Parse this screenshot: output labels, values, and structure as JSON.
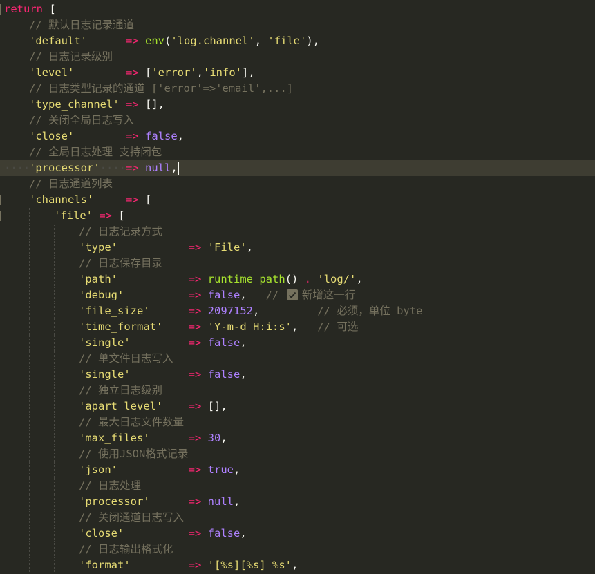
{
  "colors": {
    "background": "#272822",
    "current_line": "#3e3d32",
    "keyword": "#f92672",
    "string": "#e6db74",
    "function": "#a6e22e",
    "constant": "#ae81ff",
    "comment": "#75715e",
    "text": "#f8f8f2"
  },
  "icons": {
    "check": "check-mark-icon"
  },
  "code": {
    "l1": {
      "kw": "return",
      "pun": " ["
    },
    "l2": {
      "cmt": "// 默认日志记录通道"
    },
    "l3": {
      "key": "'default'",
      "pad": "      ",
      "op": "=>",
      "fn": "env",
      "p1": "(",
      "s1": "'log.channel'",
      "p2": ", ",
      "s2": "'file'",
      "p3": "),"
    },
    "l4": {
      "cmt": "// 日志记录级别"
    },
    "l5": {
      "key": "'level'",
      "pad": "        ",
      "op": "=>",
      "p1": " [",
      "s1": "'error'",
      "p2": ",",
      "s2": "'info'",
      "p3": "],"
    },
    "l6": {
      "cmt": "// 日志类型记录的通道 ['error'=>'email',...]"
    },
    "l7": {
      "key": "'type_channel'",
      "pad": " ",
      "op": "=>",
      "p1": " [],"
    },
    "l8": {
      "cmt": "// 关闭全局日志写入"
    },
    "l9": {
      "key": "'close'",
      "pad": "        ",
      "op": "=>",
      "c1": "false",
      "p1": ","
    },
    "l10": {
      "cmt": "// 全局日志处理 支持闭包"
    },
    "l11": {
      "key": "'processor'",
      "pad": "    ",
      "op": "=>",
      "c1": "null",
      "p1": ","
    },
    "l12": {
      "cmt": "// 日志通道列表"
    },
    "l13": {
      "key": "'channels'",
      "pad": "     ",
      "op": "=>",
      "p1": " ["
    },
    "l14": {
      "key": "'file'",
      "op": "=>",
      "p1": " ["
    },
    "l15": {
      "cmt": "// 日志记录方式"
    },
    "l16": {
      "key": "'type'",
      "pad": "           ",
      "op": "=>",
      "s1": "'File'",
      "p1": ","
    },
    "l17": {
      "cmt": "// 日志保存目录"
    },
    "l18": {
      "key": "'path'",
      "pad": "           ",
      "op": "=>",
      "fn": "runtime_path",
      "p1": "() ",
      "o2": ".",
      "s1": "'log/'",
      "p2": ","
    },
    "l19": {
      "key": "'debug'",
      "pad": "          ",
      "op": "=>",
      "c1": "false",
      "p1": ",",
      "cmt1": "//",
      "cmt2": "新增这一行"
    },
    "l20": {
      "key": "'file_size'",
      "pad": "      ",
      "op": "=>",
      "n1": "2097152",
      "p1": ",",
      "cmt": "// 必须，单位 byte"
    },
    "l21": {
      "key": "'time_format'",
      "pad": "    ",
      "op": "=>",
      "s1": "'Y-m-d H:i:s'",
      "p1": ",",
      "cmt": "// 可选"
    },
    "l22": {
      "key": "'single'",
      "pad": "         ",
      "op": "=>",
      "c1": "false",
      "p1": ","
    },
    "l23": {
      "cmt": "// 单文件日志写入"
    },
    "l24": {
      "key": "'single'",
      "pad": "         ",
      "op": "=>",
      "c1": "false",
      "p1": ","
    },
    "l25": {
      "cmt": "// 独立日志级别"
    },
    "l26": {
      "key": "'apart_level'",
      "pad": "    ",
      "op": "=>",
      "p1": " [],"
    },
    "l27": {
      "cmt": "// 最大日志文件数量"
    },
    "l28": {
      "key": "'max_files'",
      "pad": "      ",
      "op": "=>",
      "n1": "30",
      "p1": ","
    },
    "l29": {
      "cmt": "// 使用JSON格式记录"
    },
    "l30": {
      "key": "'json'",
      "pad": "           ",
      "op": "=>",
      "c1": "true",
      "p1": ","
    },
    "l31": {
      "cmt": "// 日志处理"
    },
    "l32": {
      "key": "'processor'",
      "pad": "      ",
      "op": "=>",
      "c1": "null",
      "p1": ","
    },
    "l33": {
      "cmt": "// 关闭通道日志写入"
    },
    "l34": {
      "key": "'close'",
      "pad": "          ",
      "op": "=>",
      "c1": "false",
      "p1": ","
    },
    "l35": {
      "cmt": "// 日志输出格式化"
    },
    "l36": {
      "key": "'format'",
      "pad": "         ",
      "op": "=>",
      "s1": "'[%s][%s] %s'",
      "p1": ","
    }
  }
}
